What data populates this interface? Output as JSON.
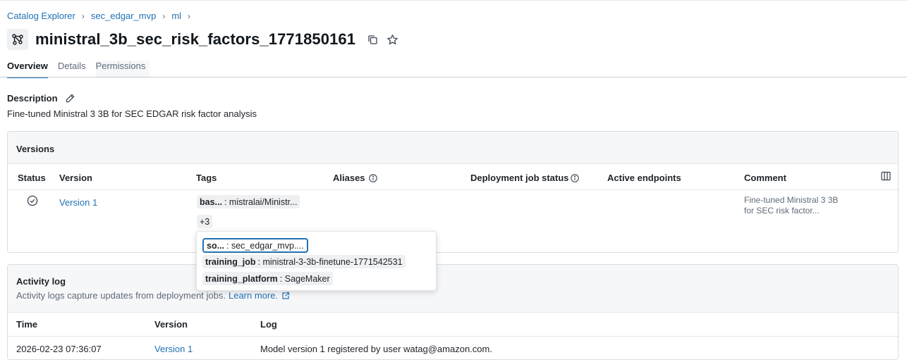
{
  "breadcrumb": {
    "items": [
      "Catalog Explorer",
      "sec_edgar_mvp",
      "ml"
    ],
    "separator": "›"
  },
  "page": {
    "title": "ministral_3b_sec_risk_factors_1771850161"
  },
  "tabs": [
    "Overview",
    "Details",
    "Permissions"
  ],
  "description": {
    "label": "Description",
    "text": "Fine-tuned Ministral 3 3B for SEC EDGAR risk factor analysis"
  },
  "versions": {
    "title": "Versions",
    "columns": [
      "Status",
      "Version",
      "Tags",
      "Aliases",
      "Deployment job status",
      "Active endpoints",
      "Comment"
    ],
    "row": {
      "version": "Version 1",
      "tag_key": "bas...",
      "tag_value": ": mistralai/Ministr...",
      "more_tags": "+3",
      "comment": "Fine-tuned Ministral 3 3B for SEC risk factor..."
    }
  },
  "popover": {
    "tags": [
      {
        "key": "so...",
        "value": ": sec_edgar_mvp...."
      },
      {
        "key": "training_job",
        "value": ": ministral-3-3b-finetune-1771542531"
      },
      {
        "key": "training_platform",
        "value": ": SageMaker"
      }
    ]
  },
  "activity": {
    "title": "Activity log",
    "subtitle": "Activity logs capture updates from deployment jobs.",
    "learn_more": "Learn more.",
    "columns": [
      "Time",
      "Version",
      "Log"
    ],
    "row": {
      "time": "2026-02-23 07:36:07",
      "version": "Version 1",
      "log": "Model version 1 registered by user watag@amazon.com."
    }
  },
  "colors": {
    "accent": "#2272b4",
    "text": "#11171c",
    "muted": "#5f6b7a"
  }
}
